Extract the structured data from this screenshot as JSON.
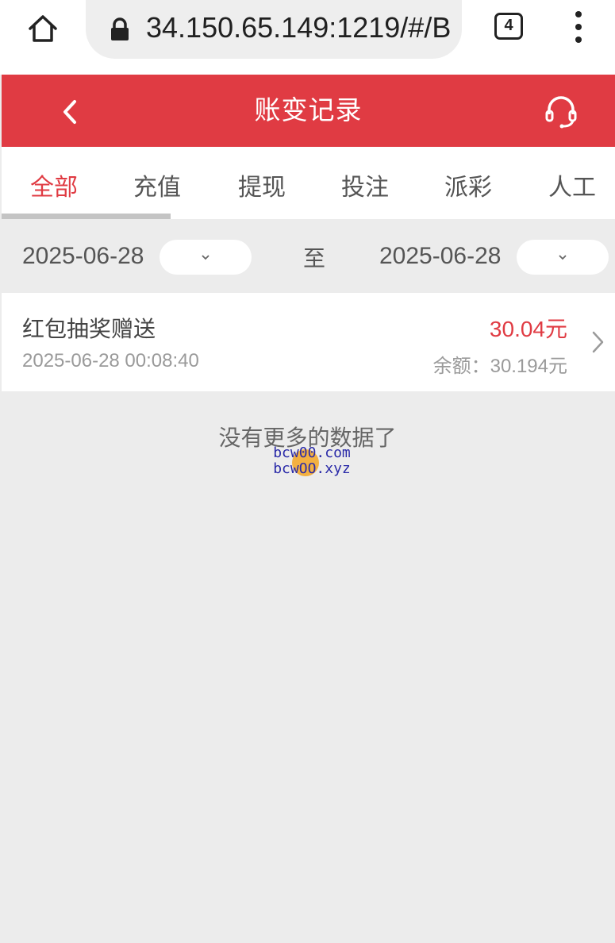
{
  "browser": {
    "url": "34.150.65.149:1219/#/B",
    "tab_count": "4",
    "icons": [
      "home-icon",
      "lock-icon",
      "more-vert-icon"
    ]
  },
  "header": {
    "title": "账变记录",
    "background_color": "#e03b43",
    "icons": [
      "chevron-left-icon",
      "headset-icon"
    ]
  },
  "tabs": [
    {
      "label": "全部",
      "active": true
    },
    {
      "label": "充值",
      "active": false
    },
    {
      "label": "提现",
      "active": false
    },
    {
      "label": "投注",
      "active": false
    },
    {
      "label": "派彩",
      "active": false
    },
    {
      "label": "人工",
      "active": false
    }
  ],
  "date_filter": {
    "start": "2025-06-28",
    "separator": "至",
    "end": "2025-06-28"
  },
  "records": [
    {
      "title": "红包抽奖赠送",
      "time": "2025-06-28 00:08:40",
      "amount": "30.04元",
      "balance": "余额：30.194元"
    }
  ],
  "list_end_text": "没有更多的数据了",
  "watermark": {
    "line1": "bcw00.com",
    "line2": "bcwOO.xyz"
  },
  "accent_color": "#e03b43"
}
